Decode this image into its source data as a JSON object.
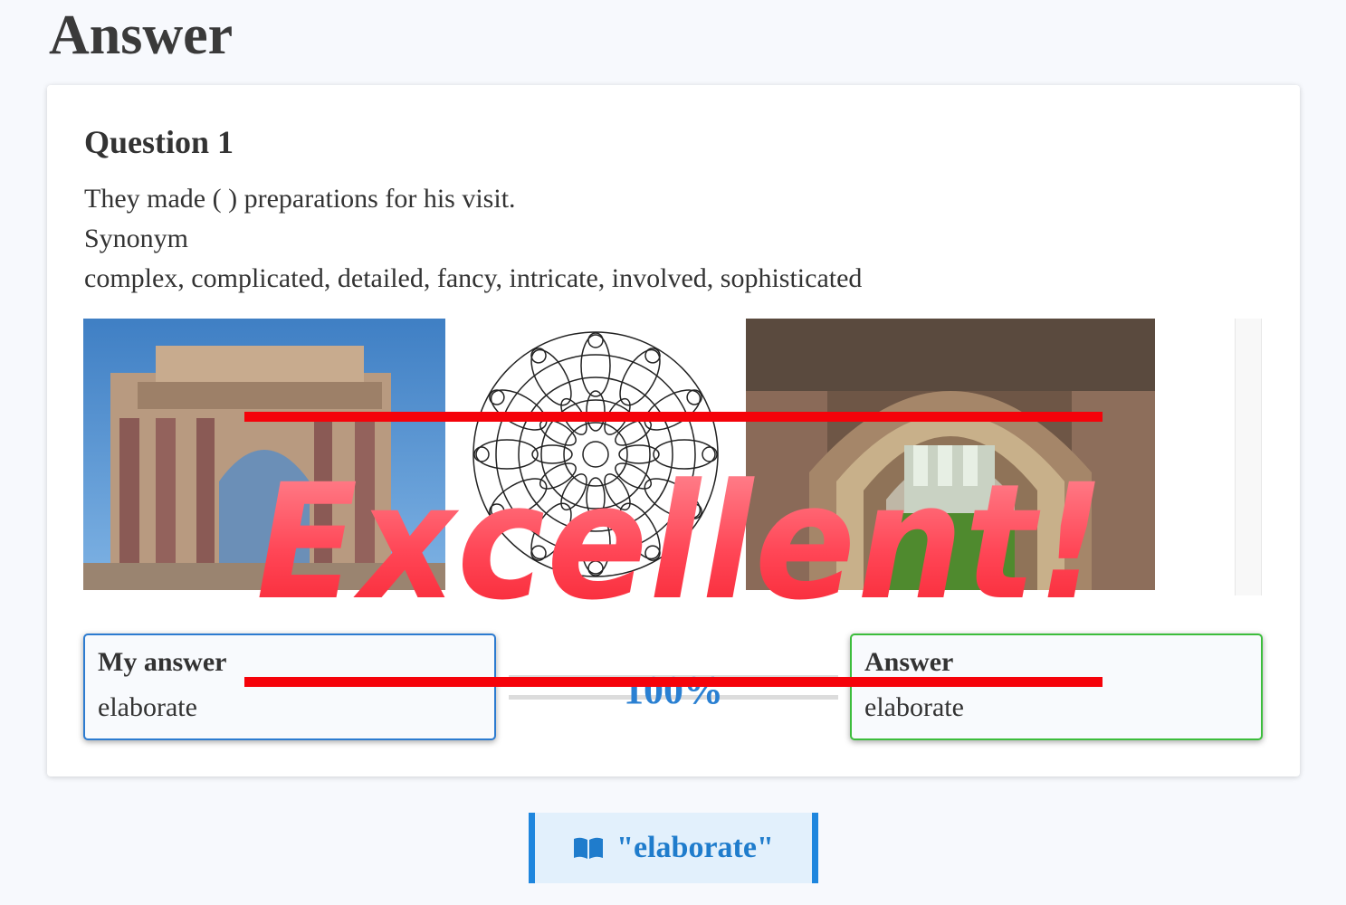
{
  "page": {
    "title": "Answer"
  },
  "question": {
    "title": "Question 1",
    "sentence": "They made ( ) preparations for his visit.",
    "synonym_label": "Synonym",
    "synonyms": "complex, complicated, detailed, fancy, intricate, involved, sophisticated"
  },
  "gallery": {
    "images": [
      {
        "name": "rotunda-photo"
      },
      {
        "name": "mandala-drawing"
      },
      {
        "name": "stone-arch-photo"
      }
    ]
  },
  "result": {
    "my_answer_label": "My answer",
    "my_answer_value": "elaborate",
    "score": "100%",
    "answer_label": "Answer",
    "answer_value": "elaborate",
    "stamp_text": "Excellent!",
    "stamp_color": "#f5202a"
  },
  "word_button": {
    "icon": "book-icon",
    "label": "\"elaborate\"",
    "accent": "#1e86de"
  }
}
